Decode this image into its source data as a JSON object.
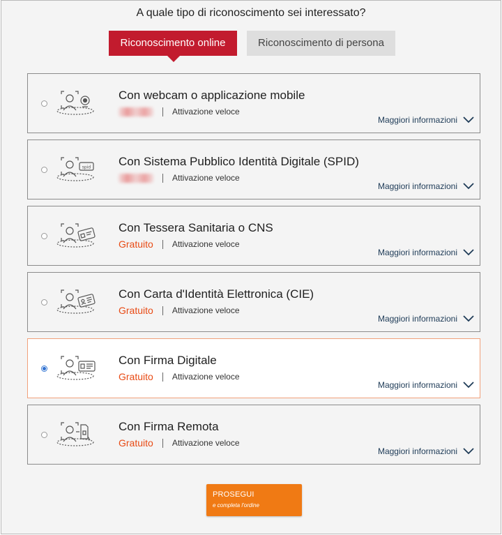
{
  "page": {
    "title": "A quale tipo di riconoscimento sei interessato?"
  },
  "tabs": [
    {
      "label": "Riconoscimento online",
      "active": true
    },
    {
      "label": "Riconoscimento di persona",
      "active": false
    }
  ],
  "options": [
    {
      "title": "Con webcam o applicazione mobile",
      "price": "",
      "price_hidden": true,
      "speed": "Attivazione veloce",
      "more": "Maggiori informazioni",
      "icon": "webcam-icon",
      "selected": false
    },
    {
      "title": "Con Sistema Pubblico Identità Digitale (SPID)",
      "price": "",
      "price_hidden": true,
      "speed": "Attivazione veloce",
      "more": "Maggiori informazioni",
      "icon": "spid-icon",
      "selected": false
    },
    {
      "title": "Con Tessera Sanitaria o CNS",
      "price": "Gratuito",
      "price_hidden": false,
      "speed": "Attivazione veloce",
      "more": "Maggiori informazioni",
      "icon": "health-card-icon",
      "selected": false
    },
    {
      "title": "Con Carta d'Identità Elettronica (CIE)",
      "price": "Gratuito",
      "price_hidden": false,
      "speed": "Attivazione veloce",
      "more": "Maggiori informazioni",
      "icon": "id-card-icon",
      "selected": false
    },
    {
      "title": "Con Firma Digitale",
      "price": "Gratuito",
      "price_hidden": false,
      "speed": "Attivazione veloce",
      "more": "Maggiori informazioni",
      "icon": "signature-card-icon",
      "selected": true
    },
    {
      "title": "Con Firma Remota",
      "price": "Gratuito",
      "price_hidden": false,
      "speed": "Attivazione veloce",
      "more": "Maggiori informazioni",
      "icon": "remote-signature-icon",
      "selected": false
    }
  ],
  "cta": {
    "label": "PROSEGUI",
    "sublabel": "e completa l'ordine"
  },
  "colors": {
    "primary_red": "#c21b2e",
    "price_orange": "#e84a14",
    "cta_orange": "#f07a14",
    "link_navy": "#1e3b57",
    "selected_border": "#f0a07a"
  }
}
